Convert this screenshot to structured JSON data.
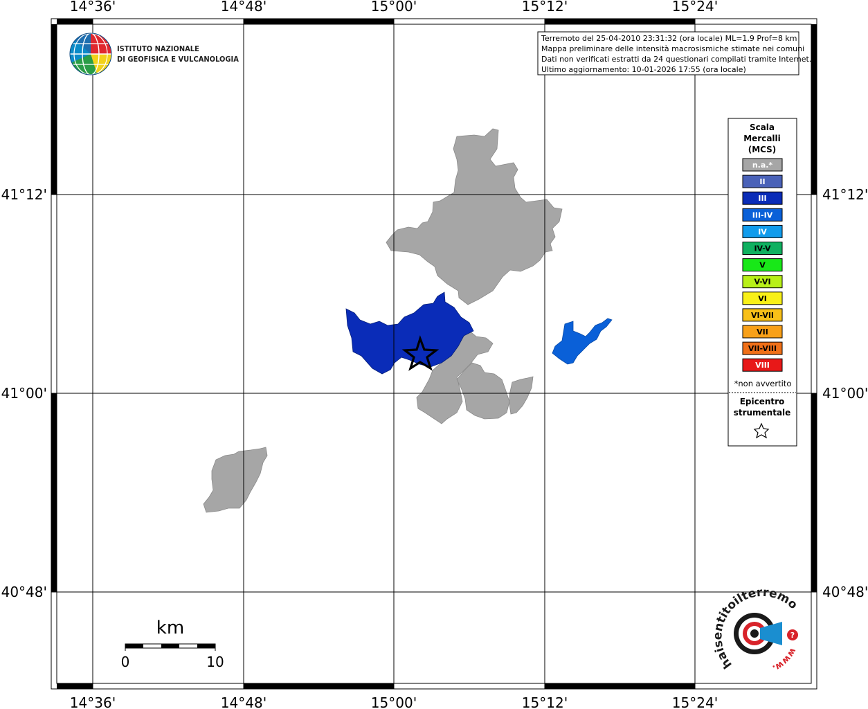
{
  "grid": {
    "lon_labels": [
      "14°36'",
      "14°48'",
      "15°00'",
      "15°12'",
      "15°24'"
    ],
    "lat_labels": [
      "41°12'",
      "41°00'",
      "40°48'"
    ]
  },
  "info": {
    "lines": [
      "Terremoto del 25-04-2010 23:31:32 (ora locale) ML=1.9 Prof=8 km",
      "Mappa preliminare delle intensità macrosismiche stimate nei comuni",
      "Dati non verificati estratti da 24 questionari compilati tramite Internet.",
      "Ultimo aggiornamento: 10-01-2026 17:55 (ora locale)"
    ]
  },
  "ingv_logo": {
    "line1": "ISTITUTO NAZIONALE",
    "line2": "DI GEOFISICA E VULCANOLOGIA"
  },
  "legend": {
    "title": [
      "Scala",
      "Mercalli",
      "(MCS)"
    ],
    "entries": [
      {
        "label": "n.a.*",
        "color": "#a6a6a6",
        "text_color": "#ffffff"
      },
      {
        "label": "II",
        "color": "#4a62b8",
        "text_color": "#ffffff"
      },
      {
        "label": "III",
        "color": "#0a2cb8",
        "text_color": "#ffffff"
      },
      {
        "label": "III-IV",
        "color": "#0a60d8",
        "text_color": "#ffffff"
      },
      {
        "label": "IV",
        "color": "#119cec",
        "text_color": "#ffffff"
      },
      {
        "label": "IV-V",
        "color": "#10b060",
        "text_color": "#000000"
      },
      {
        "label": "V",
        "color": "#18e818",
        "text_color": "#000000"
      },
      {
        "label": "V-VI",
        "color": "#b8f018",
        "text_color": "#000000"
      },
      {
        "label": "VI",
        "color": "#f8f018",
        "text_color": "#000000"
      },
      {
        "label": "VI-VII",
        "color": "#f8c018",
        "text_color": "#000000"
      },
      {
        "label": "VII",
        "color": "#f8a018",
        "text_color": "#000000"
      },
      {
        "label": "VII-VIII",
        "color": "#f07018",
        "text_color": "#000000"
      },
      {
        "label": "VIII",
        "color": "#e81818",
        "text_color": "#ffffff"
      }
    ],
    "note": "*non avvertito",
    "epicenter_title": [
      "Epicentro",
      "strumentale"
    ]
  },
  "scale_bar": {
    "unit": "km",
    "min_label": "0",
    "max_label": "10"
  },
  "hst_logo": {
    "text": "haisentitoilterremoto.it",
    "prefix": "www."
  },
  "map_colors": {
    "na": "#a6a6a6",
    "III": "#0a2cb8",
    "III-IV": "#0a60d8"
  }
}
